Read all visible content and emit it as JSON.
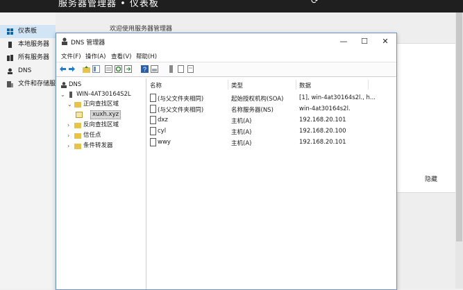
{
  "server_manager": {
    "title": "服务器管理器 • 仪表板",
    "welcome": "欢迎使用服务器管理器",
    "hide": "隐藏",
    "sidebar": [
      {
        "label": "仪表板",
        "icon": "dashboard-icon",
        "active": true
      },
      {
        "label": "本地服务器",
        "icon": "server-icon",
        "active": false
      },
      {
        "label": "所有服务器",
        "icon": "servers-icon",
        "active": false
      },
      {
        "label": "DNS",
        "icon": "dns-icon",
        "active": false
      },
      {
        "label": "文件和存储服务",
        "icon": "storage-icon",
        "active": false
      }
    ]
  },
  "dns_window": {
    "title": "DNS 管理器",
    "controls": {
      "minimize": "—",
      "maximize": "☐",
      "close": "✕"
    },
    "menu": [
      "文件(F)",
      "操作(A)",
      "查看(V)",
      "帮助(H)"
    ],
    "tree": {
      "root": "DNS",
      "server": "WIN-4AT30164S2L",
      "forward": "正向查找区域",
      "zone": "xuxh.xyz",
      "reverse": "反向查找区域",
      "trust": "信任点",
      "conditional": "条件转发器"
    },
    "columns": [
      "名称",
      "类型",
      "数据"
    ],
    "records": [
      {
        "name": "(与父文件夹相同)",
        "type": "起始授权机构(SOA)",
        "data": "[1], win-4at30164s2l., h..."
      },
      {
        "name": "(与父文件夹相同)",
        "type": "名称服务器(NS)",
        "data": "win-4at30164s2l."
      },
      {
        "name": "dxz",
        "type": "主机(A)",
        "data": "192.168.20.101"
      },
      {
        "name": "cyl",
        "type": "主机(A)",
        "data": "192.168.20.100"
      },
      {
        "name": "wwy",
        "type": "主机(A)",
        "data": "192.168.20.101"
      }
    ]
  },
  "colors": {
    "accent": "#0a64ad",
    "selection": "#d1e5f7",
    "titlebar": "#1f1f1f"
  }
}
